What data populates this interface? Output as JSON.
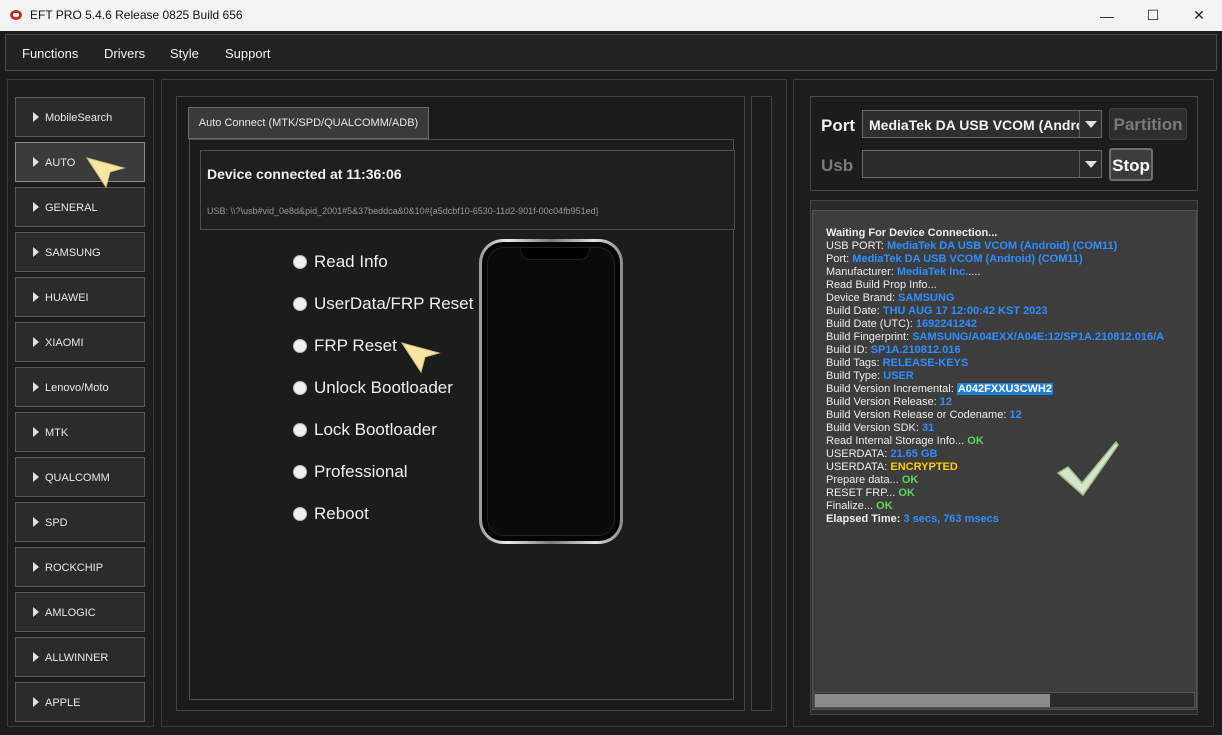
{
  "window": {
    "title": "EFT PRO 5.4.6 Release 0825 Build 656",
    "minimize": "—",
    "maximize": "☐",
    "close": "✕"
  },
  "menu": [
    "Functions",
    "Drivers",
    "Style",
    "Support"
  ],
  "sidebar": {
    "active": "AUTO",
    "items": [
      "MobileSearch",
      "AUTO",
      "GENERAL",
      "SAMSUNG",
      "HUAWEI",
      "XIAOMI",
      "Lenovo/Moto",
      "MTK",
      "QUALCOMM",
      "SPD",
      "ROCKCHIP",
      "AMLOGIC",
      "ALLWINNER",
      "APPLE"
    ]
  },
  "main": {
    "tab_label": "Auto Connect (MTK/SPD/QUALCOMM/ADB)",
    "device_status": "Device connected at 11:36:06",
    "usb_path": "USB: \\\\?\\usb#vid_0e8d&pid_2001#5&37beddca&0&10#{a5dcbf10-6530-11d2-901f-00c04fb951ed}",
    "options": [
      "Read Info",
      "UserData/FRP Reset",
      "FRP Reset",
      "Unlock Bootloader",
      "Lock Bootloader",
      "Professional",
      "Reboot"
    ]
  },
  "connection": {
    "port_label": "Port",
    "port_value": "MediaTek DA USB VCOM (Android",
    "usb_label": "Usb",
    "usb_value": "",
    "partition_button": "Partition",
    "stop_button": "Stop"
  },
  "log": {
    "scroll_position": 0.62,
    "lines": [
      {
        "text": "Waiting For Device Connection...",
        "bold": true
      },
      {
        "label": "USB PORT: ",
        "value": "MediaTek DA USB VCOM (Android) (COM11)",
        "kind": "v"
      },
      {
        "label": "Port: ",
        "value": "MediaTek DA USB VCOM (Android) (COM11)",
        "kind": "v"
      },
      {
        "label": "Manufacturer: ",
        "value": "MediaTek Inc.",
        "kind": "v",
        "suffix": "...."
      },
      {
        "text": "Read Build Prop Info..."
      },
      {
        "label": " Device Brand: ",
        "value": "SAMSUNG",
        "kind": "v"
      },
      {
        "label": " Build Date: ",
        "value": "THU AUG 17 12:00:42 KST 2023",
        "kind": "v"
      },
      {
        "label": " Build Date (UTC): ",
        "value": "1692241242",
        "kind": "v"
      },
      {
        "label": " Build Fingerprint: ",
        "value": "SAMSUNG/A04EXX/A04E:12/SP1A.210812.016/A",
        "kind": "v"
      },
      {
        "label": " Build ID: ",
        "value": "SP1A.210812.016",
        "kind": "v"
      },
      {
        "label": " Build Tags: ",
        "value": "RELEASE-KEYS",
        "kind": "v"
      },
      {
        "label": " Build Type: ",
        "value": "USER",
        "kind": "v"
      },
      {
        "label": " Build Version Incremental: ",
        "value": "A042FXXU3CWH2",
        "kind": "hl"
      },
      {
        "label": " Build Version Release: ",
        "value": "12",
        "kind": "v"
      },
      {
        "label": " Build Version Release or Codename: ",
        "value": "12",
        "kind": "v"
      },
      {
        "label": " Build Version SDK: ",
        "value": "31",
        "kind": "v"
      },
      {
        "label": "Read Internal Storage Info... ",
        "value": "OK",
        "kind": "ok"
      },
      {
        "label": "USERDATA: ",
        "value": "21.65 GB",
        "kind": "v"
      },
      {
        "label": "USERDATA: ",
        "value": "ENCRYPTED",
        "kind": "enc"
      },
      {
        "label": "Prepare data... ",
        "value": "OK",
        "kind": "ok"
      },
      {
        "label": "RESET FRP... ",
        "value": "OK",
        "kind": "ok"
      },
      {
        "label": "Finalize... ",
        "value": "OK",
        "kind": "ok"
      },
      {
        "label": "Elapsed Time: ",
        "value": "3 secs, 763 msecs",
        "kind": "v",
        "bold": true
      }
    ]
  },
  "colors": {
    "log_value": "#2f8fff",
    "log_ok": "#5cd65c",
    "log_encrypted": "#ffcc00",
    "cursor_arrow": "#f7e7a0",
    "check": "#d8e8c8"
  },
  "icons": {
    "app": "eft-logo-icon",
    "pointer": "arrow-pointer-icon",
    "check": "checkmark-icon"
  }
}
